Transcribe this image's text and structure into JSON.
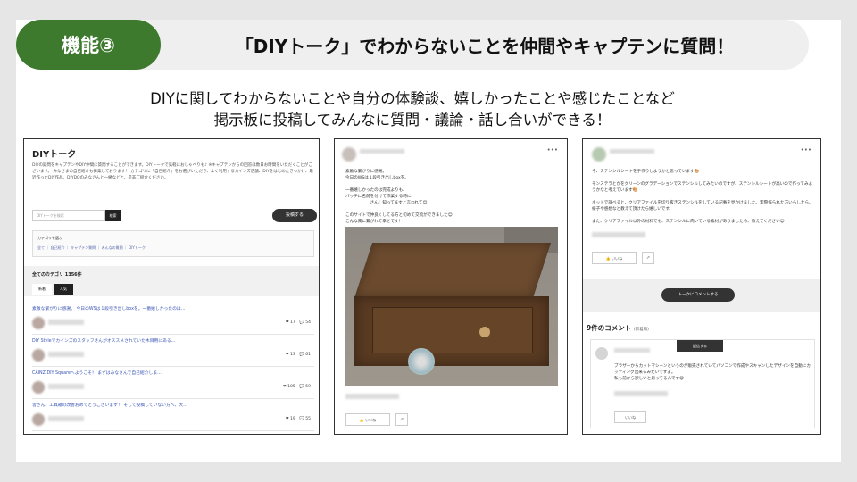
{
  "header": {
    "feature_label": "機能③",
    "title": "「DIYトーク」でわからないことを仲間やキャプテンに質問！"
  },
  "subtitle": {
    "line1": "DIYに関してわからないことや自分の体験談、嬉しかったことや感じたことなど",
    "line2": "掲示板に投稿してみんなに質問・議論・話し合いができる！"
  },
  "board": {
    "title": "DIYトーク",
    "description": "DIYの疑問をキャプテンやDIY仲間に質問することができます。DIYトークで気軽におしゃべりも♪ ※キャプテンからの回答は数日お時間をいただくことがございます。 みなさまの自己紹介も募集しております！ カテゴリに「自己紹介」をお選びいただき、よく利用するカインズ店舗、DIYをはじめたきっかけ、最近作ったDIY作品、DIYDOのみなさんと一緒などと、是非ご紹介ください。",
    "search_placeholder": "DIYトークを検索",
    "search_button": "検索",
    "post_button": "投稿する",
    "category_label": "カテゴリを選ぶ",
    "category_links": "全て ｜ 自己紹介 ｜ キャプテン質問 ｜ みんなの質問 ｜ DIYトーク",
    "all_categories": "全てのカテゴリ 1356件",
    "tab_new": "新着",
    "tab_popular": "人気",
    "rows": [
      {
        "title": "素敵な繋がりに感謝。 今日のWSは１段引き出しboxを。一番嬉しかったのは…",
        "stats": "❤ 17　💬 54"
      },
      {
        "title": "DIY Styleでカインズのスタッフさんがオススメされていた木目用にある…",
        "stats": "❤ 13　💬 61"
      },
      {
        "title": "CAINZ DIY Squareへようこそ！ まずはみなさんで自己紹介しま…",
        "stats": "❤ 105　💬 59"
      },
      {
        "title": "皆さん、工具箱の改善おめでとうございます！ そして投稿していない方へ、大…",
        "stats": "❤ 19　💬 55"
      }
    ]
  },
  "post": {
    "body": "素敵な繋がりに感謝。\n今日のWSは１段引き出しboxを。\n\n一番嬉しかったのは完成よりも、\nバッチに名前を付けて作業する時に、\n　　　　　　さん！知ってますと言われて😊\n\nこのサイトで仲良くしてる方と初めて交流ができました😊\nこんな風に繋がれて幸せです！",
    "like_label": "いいね",
    "share_icon": "share-icon"
  },
  "thread": {
    "body": "今、ステンシルシートを手作りしようかと思っています🎨\n\nモンステラとかをグリーンのグラデーションでステンシルしてみたいのですが、ステンシルシートが高いので作ってみようかなと考えています🎨\n\nネットで調べると、クリアファイルを切り抜きステンシルをしている記事を見かけました。実際作られた方いらしたら、様子や感想など教えて頂けたら嬉しいです。\n\nまた、クリアファイル以外の材料でも、ステンシルに向いている素材がありましたら、教えてください😊",
    "like_label": "いいね",
    "comment_button": "トークにコメントする",
    "comments_heading": "9件のコメント",
    "comments_order": "(新着順)",
    "comment_body": "ブラザーからカットマシーンというのが販売されていてパソコンで作成やスキャンしたデザインを自動にカッティング出来るみたいですよ。\n私も前から欲しいと思ってるんです😊",
    "comment_like": "いいね",
    "comment_reply": "返信する"
  },
  "colors": {
    "accent_green": "#3e7a2e",
    "header_bar": "#efefef",
    "link_blue": "#3a55b5"
  }
}
